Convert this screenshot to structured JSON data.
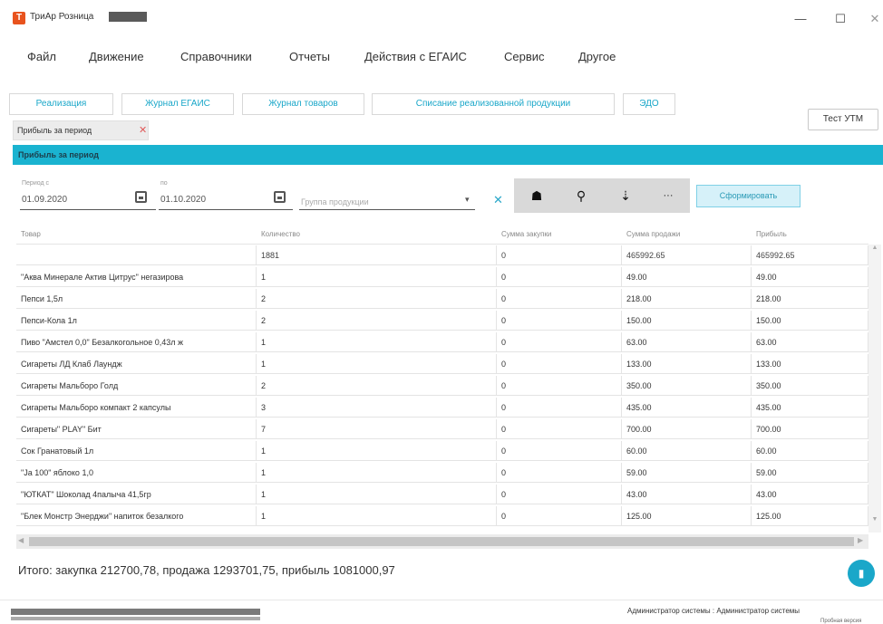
{
  "window": {
    "title": "ТриАр Розница",
    "app_icon": "Т",
    "controls": {
      "minimize": "—",
      "maximize": "☐",
      "close": "✕"
    }
  },
  "menu": [
    "Файл",
    "Движение",
    "Справочники",
    "Отчеты",
    "Действия с ЕГАИС",
    "Сервис",
    "Другое"
  ],
  "tabs": [
    "Реализация",
    "Журнал ЕГАИС",
    "Журнал товаров",
    "Списание реализованной продукции",
    "ЭДО"
  ],
  "test_utm_label": "Тест УТМ",
  "doc_tab": {
    "label": "Прибыль за период",
    "close": "✕"
  },
  "panel_title": "Прибыль за период",
  "filters": {
    "from_label": "Период с",
    "from_value": "01.09.2020",
    "to_label": "по",
    "to_value": "01.10.2020",
    "group_placeholder": "Группа продукции",
    "clear_icon": "✕",
    "dropdown_icon": "▾"
  },
  "toolbar": {
    "icons": [
      "home-icon",
      "pin-icon",
      "sort-icon",
      "more-icon"
    ],
    "glyphs": [
      "☗",
      "⚲",
      "⇣",
      "···"
    ],
    "form_button": "Сформировать"
  },
  "table": {
    "columns": [
      "Товар",
      "Количество",
      "Сумма закупки",
      "Сумма продажи",
      "Прибыль"
    ],
    "summary": [
      "",
      "1881",
      "0",
      "465992.65",
      "465992.65"
    ],
    "rows": [
      [
        "\"Аква Минерале Актив Цитрус\" негазирова",
        "1",
        "0",
        "49.00",
        "49.00"
      ],
      [
        "Пепси 1,5л",
        "2",
        "0",
        "218.00",
        "218.00"
      ],
      [
        "Пепси-Кола 1л",
        "2",
        "0",
        "150.00",
        "150.00"
      ],
      [
        "Пиво \"Амстел 0,0\" Безалкогольное 0,43л ж",
        "1",
        "0",
        "63.00",
        "63.00"
      ],
      [
        "Сигареты ЛД Клаб Лаундж",
        "1",
        "0",
        "133.00",
        "133.00"
      ],
      [
        "Сигареты Мальборо Голд",
        "2",
        "0",
        "350.00",
        "350.00"
      ],
      [
        "Сигареты Мальборо компакт 2 капсулы",
        "3",
        "0",
        "435.00",
        "435.00"
      ],
      [
        "Сигареты\" PLAY\" Бит",
        "7",
        "0",
        "700.00",
        "700.00"
      ],
      [
        "Сок Гранатовый 1л",
        "1",
        "0",
        "60.00",
        "60.00"
      ],
      [
        "\"Ja 100\" яблоко 1,0",
        "1",
        "0",
        "59.00",
        "59.00"
      ],
      [
        "\"ЮТКАТ\" Шоколад 4палыча 41,5гр",
        "1",
        "0",
        "43.00",
        "43.00"
      ],
      [
        "\"Блек Монстр Энерджи\" напиток безалкого",
        "1",
        "0",
        "125.00",
        "125.00"
      ]
    ]
  },
  "totals": "Итого: закупка 212700,78, продажа 1293701,75, прибыль 1081000,97",
  "fab_icon": "▮",
  "status": {
    "user": "Администратор системы : Администратор системы",
    "version": "Пробная версия"
  }
}
